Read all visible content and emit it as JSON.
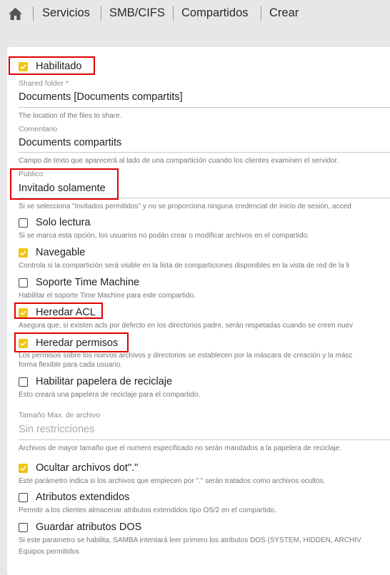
{
  "breadcrumb": {
    "items": [
      "Servicios",
      "SMB/CIFS",
      "Compartidos",
      "Crear"
    ]
  },
  "form": {
    "enabled": {
      "label": "Habilitado",
      "checked": true
    },
    "shared_folder": {
      "label": "Shared folder *",
      "value": "Documents [Documents compartits]",
      "hint": "The location of the files to share."
    },
    "comment": {
      "label": "Comentario",
      "value": "Documents compartits",
      "hint": "Campo de texto que aparecerá al lado de una compartición cuando los clientes examinen el servidor."
    },
    "public": {
      "label": "Público",
      "value": "Invitado solamente",
      "hint": "Si se selecciona \"Invitados permitidos\" y no se proporciona ninguna credencial de inicio de sesión, acced"
    },
    "checkboxes": [
      {
        "label": "Solo lectura",
        "checked": false,
        "hint": "Si se marca esta opción, los usuarios no podán crear o modificar archivos en el compartido."
      },
      {
        "label": "Navegable",
        "checked": true,
        "hint": "Controla si la compartición será visible en la lista de comparticiones disponibles en la vista de red de la li"
      },
      {
        "label": "Soporte Time Machine",
        "checked": false,
        "hint": "Habilitar el soporte Time Machine para este compartido."
      },
      {
        "label": "Heredar ACL",
        "checked": true,
        "hint": "Asegura que, si existen acls por defecto en los directorios padre, serán respetadas cuando se creen nuev"
      },
      {
        "label": "Heredar permisos",
        "checked": true,
        "hint": "Los permisos sobre los nuevos archivos y directorios se establecen por la máscara de creación y la másc",
        "hint2": "forma flexible para cada usuario."
      },
      {
        "label": "Habilitar papelera de reciclaje",
        "checked": false,
        "hint": "Esto creará una papelera de reciclaje para el compartido."
      }
    ],
    "max_file_size": {
      "label": "Tamaño Max. de archivo",
      "placeholder": "Sin restricciones",
      "hint": "Archivos de mayor tamaño que el numero especificado no serán mandados a la papelera de reciclaje."
    },
    "checkboxes2": [
      {
        "label": "Ocultar archivos dot\".\"",
        "checked": true,
        "hint": "Este parámetro indica si los archivos que empiecen por \".\" serán tratados como archivos ocultos."
      },
      {
        "label": "Atributos extendidos",
        "checked": false,
        "hint": "Permitir a los clientes almacenar atributos extendidos tipo OS/2 en el compartido."
      },
      {
        "label": "Guardar atributos DOS",
        "checked": false,
        "hint": "Si este parametro se habilita, SAMBA intentará leer primero los atributos DOS (SYSTEM, HIDDEN, ARCHIV",
        "hint2": "Equipos permitidos"
      }
    ]
  },
  "colors": {
    "background": "#e7e7e9",
    "panel": "#ffffff",
    "checkbox_checked": "#f3c511",
    "highlight_box": "#e00000"
  }
}
